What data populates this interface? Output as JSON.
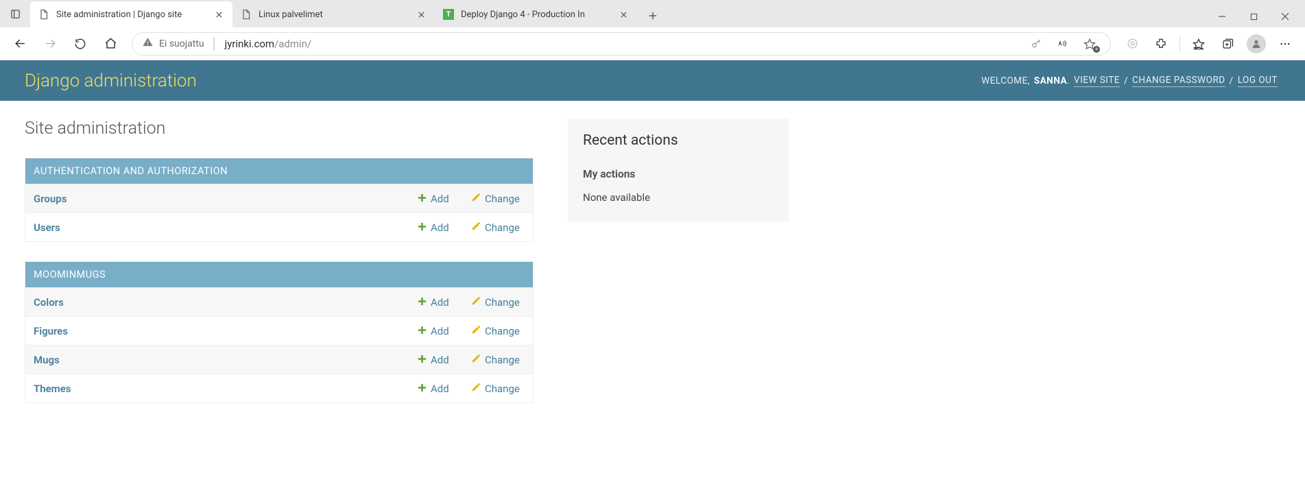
{
  "browser": {
    "tabs": [
      {
        "title": "Site administration | Django site",
        "active": true,
        "favicon": "page"
      },
      {
        "title": "Linux palvelimet",
        "active": false,
        "favicon": "page"
      },
      {
        "title": "Deploy Django 4 - Production In",
        "active": false,
        "favicon": "t"
      }
    ],
    "security_label": "Ei suojattu",
    "url_host": "jyrinki.com",
    "url_path": "/admin/"
  },
  "django": {
    "brand": "Django administration",
    "welcome": "WELCOME,",
    "username": "SANNA",
    "view_site": "VIEW SITE",
    "change_password": "CHANGE PASSWORD",
    "logout": "LOG OUT",
    "page_title": "Site administration",
    "add": "Add",
    "change": "Change",
    "apps": [
      {
        "label": "AUTHENTICATION AND AUTHORIZATION",
        "models": [
          {
            "name": "Groups"
          },
          {
            "name": "Users"
          }
        ]
      },
      {
        "label": "MOOMINMUGS",
        "models": [
          {
            "name": "Colors"
          },
          {
            "name": "Figures"
          },
          {
            "name": "Mugs"
          },
          {
            "name": "Themes"
          }
        ]
      }
    ],
    "recent_actions": {
      "title": "Recent actions",
      "subtitle": "My actions",
      "empty": "None available"
    }
  }
}
